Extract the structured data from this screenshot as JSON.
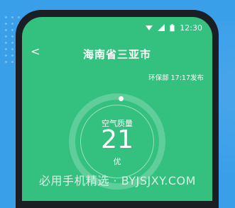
{
  "statusbar": {
    "time": "12:30",
    "icons": [
      "wifi-icon",
      "signal-icon",
      "battery-icon"
    ]
  },
  "header": {
    "back_icon": "chevron-left-icon",
    "back_glyph": "<",
    "title": "海南省三亚市"
  },
  "publish_info": "环保部 17:17发布",
  "air_quality": {
    "label": "空气质量",
    "value": "21",
    "level": "优"
  },
  "watermark": "必用手机精选 · BYJSJXY.COM",
  "colors": {
    "background": "#3a9fe9",
    "screen": "#34c07e",
    "phone": "#1b1f24"
  }
}
